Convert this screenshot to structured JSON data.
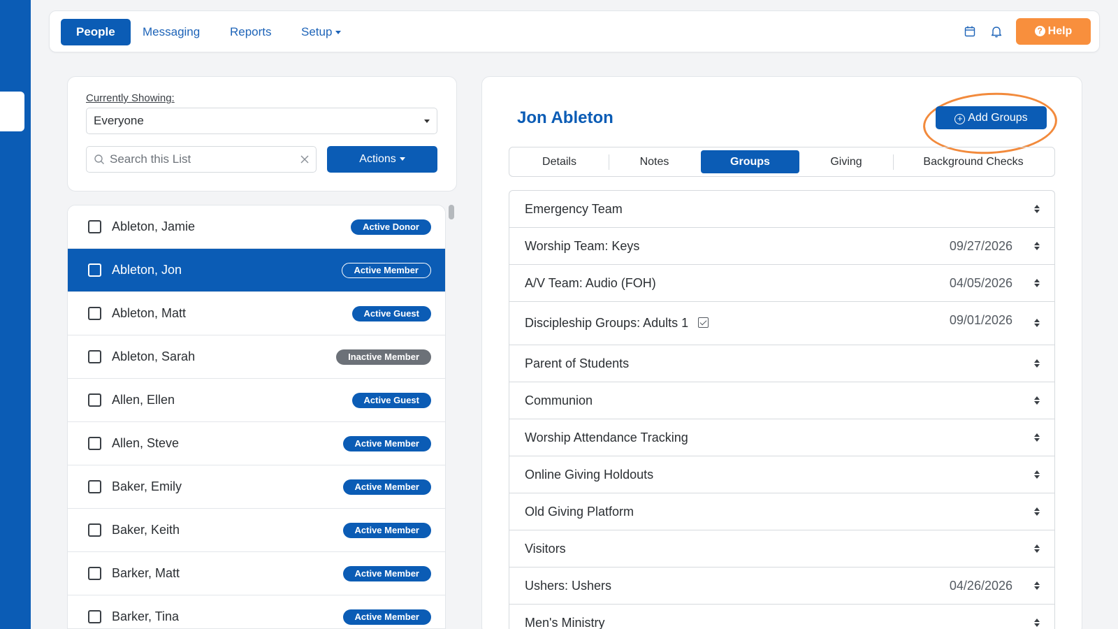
{
  "nav": {
    "items": [
      {
        "label": "People",
        "active": true
      },
      {
        "label": "Messaging",
        "active": false
      },
      {
        "label": "Reports",
        "active": false
      },
      {
        "label": "Setup",
        "active": false
      }
    ],
    "icons": [
      "calendar-icon",
      "bell-icon"
    ],
    "help_label": "Help"
  },
  "filter": {
    "showing_label": "Currently Showing:",
    "showing_value": "Everyone",
    "search_placeholder": "Search this List",
    "actions_label": "Actions"
  },
  "people": [
    {
      "name": "Ableton, Jamie",
      "status": "Active Donor",
      "selected": false
    },
    {
      "name": "Ableton, Jon",
      "status": "Active Member",
      "selected": true
    },
    {
      "name": "Ableton, Matt",
      "status": "Active Guest",
      "selected": false
    },
    {
      "name": "Ableton, Sarah",
      "status": "Inactive Member",
      "selected": false
    },
    {
      "name": "Allen, Ellen",
      "status": "Active Guest",
      "selected": false
    },
    {
      "name": "Allen, Steve",
      "status": "Active Member",
      "selected": false
    },
    {
      "name": "Baker, Emily",
      "status": "Active Member",
      "selected": false
    },
    {
      "name": "Baker, Keith",
      "status": "Active Member",
      "selected": false
    },
    {
      "name": "Barker, Matt",
      "status": "Active Member",
      "selected": false
    },
    {
      "name": "Barker, Tina",
      "status": "Active Member",
      "selected": false
    }
  ],
  "detail": {
    "person_name": "Jon Ableton",
    "add_groups_label": "Add Groups",
    "tabs": [
      {
        "label": "Details",
        "active": false
      },
      {
        "label": "Notes",
        "active": false
      },
      {
        "label": "Groups",
        "active": true
      },
      {
        "label": "Giving",
        "active": false
      },
      {
        "label": "Background Checks",
        "active": false
      }
    ],
    "groups": [
      {
        "name": "Emergency Team",
        "date": ""
      },
      {
        "name": "Worship Team: Keys",
        "date": "09/27/2026"
      },
      {
        "name": "A/V Team: Audio (FOH)",
        "date": "04/05/2026"
      },
      {
        "name": "Discipleship Groups: Adults 1",
        "date": "09/01/2026",
        "checked": true
      },
      {
        "name": "Parent of Students",
        "date": ""
      },
      {
        "name": "Communion",
        "date": ""
      },
      {
        "name": "Worship Attendance Tracking",
        "date": ""
      },
      {
        "name": "Online Giving Holdouts",
        "date": ""
      },
      {
        "name": "Old Giving Platform",
        "date": ""
      },
      {
        "name": "Visitors",
        "date": ""
      },
      {
        "name": "Ushers: Ushers",
        "date": "04/26/2026"
      },
      {
        "name": "Men's Ministry",
        "date": ""
      }
    ]
  },
  "colors": {
    "brand_blue": "#0b5cb5",
    "help_orange": "#f88f3d",
    "inactive_gray": "#6c7178",
    "highlight_orange": "#f28a3c"
  }
}
